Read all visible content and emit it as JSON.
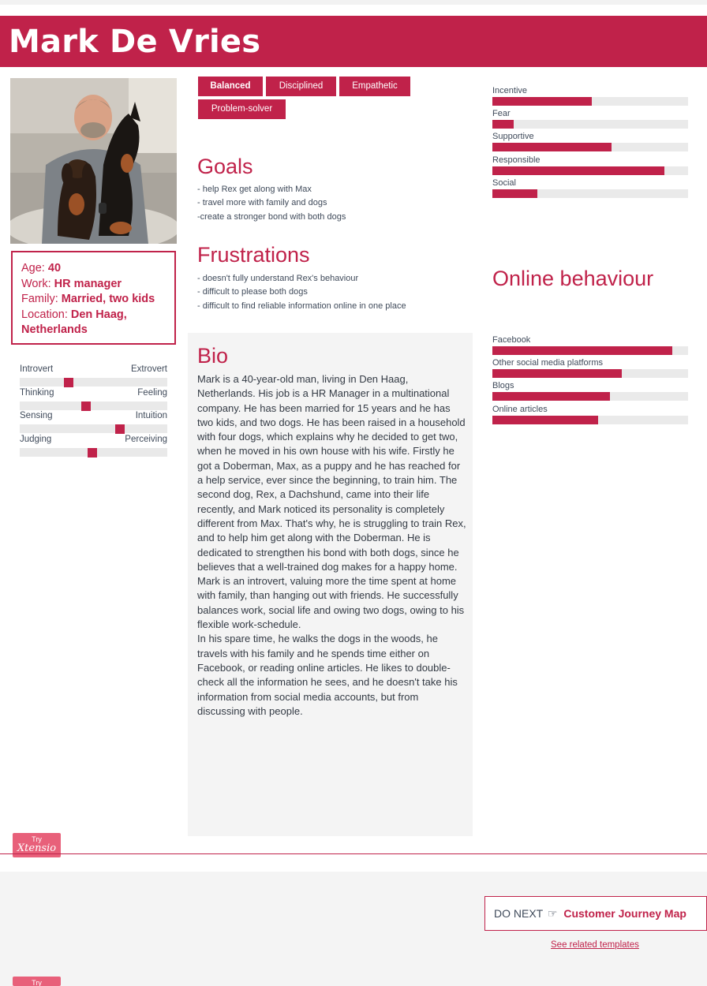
{
  "header": {
    "name": "Mark De Vries"
  },
  "photo": {
    "alt": "Man sitting on a sofa with a Doberman and a Dachshund"
  },
  "info": {
    "age_label": "Age:",
    "age": "40",
    "work_label": "Work:",
    "work": "HR manager",
    "family_label": "Family:",
    "family": "Married, two kids",
    "location_label": "Location:",
    "location": "Den Haag, Netherlands"
  },
  "personality": [
    {
      "left": "Introvert",
      "right": "Extrovert",
      "value": 0.33
    },
    {
      "left": "Thinking",
      "right": "Feeling",
      "value": 0.45
    },
    {
      "left": "Sensing",
      "right": "Intuition",
      "value": 0.68
    },
    {
      "left": "Judging",
      "right": "Perceiving",
      "value": 0.49
    }
  ],
  "tags": [
    "Balanced",
    "Disciplined",
    "Empathetic",
    "Problem-solver"
  ],
  "goals": {
    "title": "Goals",
    "items": [
      "- help Rex get along with Max",
      "- travel more with family and dogs",
      "-create a stronger bond with both dogs"
    ]
  },
  "frustrations": {
    "title": "Frustrations",
    "items": [
      "- doesn't fully understand Rex's behaviour",
      "- difficult to please both dogs",
      "- difficult to find reliable information online in one place"
    ]
  },
  "bio": {
    "title": "Bio",
    "paragraphs": [
      "Mark is a 40-year-old man, living in Den Haag, Netherlands. His job is a HR Manager in a multinational company. He has been married for 15 years and he has two kids, and two dogs. He has been raised in a household with four dogs, which explains why he decided to get two, when he moved in his own house with his wife. Firstly he got a Doberman, Max, as a puppy and he has reached for a help service, ever since the beginning, to train him. The second dog, Rex, a Dachshund, came into their life recently, and Mark noticed its personality is completely different from Max. That's why, he is struggling to train Rex, and to help him get along with the Doberman. He is dedicated to strengthen his bond with both dogs, since he believes that a well-trained dog makes for a happy home.",
      "Mark is an introvert, valuing more the time spent at home with family, than hanging out with friends. He successfully balances work, social life and owing two dogs, owing to his flexible work-schedule.",
      "In his spare time, he walks the dogs in the woods, he travels with his family and he spends time either on Facebook, or reading online articles. He likes to double-check all the information he sees, and he doesn't take his information from social media accounts, but from discussing with people."
    ]
  },
  "motivations": [
    {
      "label": "Incentive",
      "value": 0.51
    },
    {
      "label": "Fear",
      "value": 0.11
    },
    {
      "label": "Supportive",
      "value": 0.61
    },
    {
      "label": "Responsible",
      "value": 0.88
    },
    {
      "label": "Social",
      "value": 0.23
    }
  ],
  "online": {
    "title": "Online behaviour",
    "items": [
      {
        "label": "Facebook",
        "value": 0.92
      },
      {
        "label": "Other social media platforms",
        "value": 0.66
      },
      {
        "label": "Blogs",
        "value": 0.6
      },
      {
        "label": "Online articles",
        "value": 0.54
      }
    ]
  },
  "badge": {
    "try": "Try",
    "brand": "Xtensio"
  },
  "footer": {
    "do_next": "DO NEXT",
    "hand_icon": "pointing-hand-icon",
    "next_link": "Customer Journey Map",
    "related": "See related templates"
  },
  "colors": {
    "accent": "#c0224a",
    "badge": "#e8607a",
    "panel": "#f4f4f4"
  }
}
